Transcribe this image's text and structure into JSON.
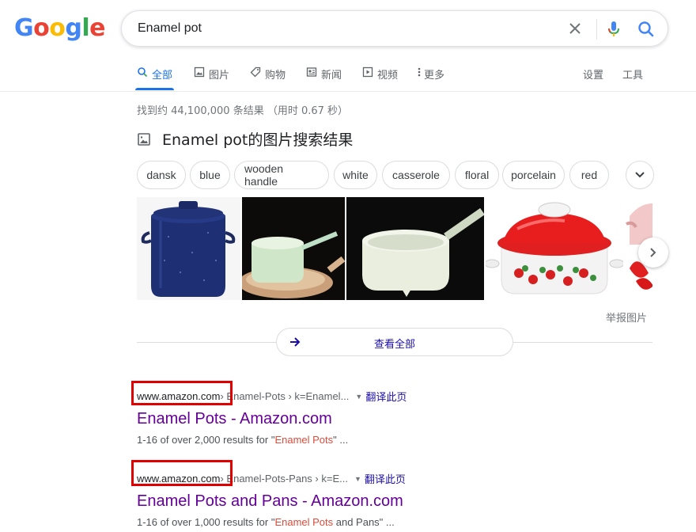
{
  "logo": [
    "G",
    "o",
    "o",
    "g",
    "l",
    "e"
  ],
  "search": {
    "query": "Enamel pot"
  },
  "tabs": [
    {
      "label": "全部",
      "icon": "search-icon",
      "active": true
    },
    {
      "label": "图片",
      "icon": "image-icon"
    },
    {
      "label": "购物",
      "icon": "tag-icon"
    },
    {
      "label": "新闻",
      "icon": "news-icon"
    },
    {
      "label": "视频",
      "icon": "video-icon"
    },
    {
      "label": "更多",
      "icon": "more-vertical-icon"
    }
  ],
  "tools": {
    "settings": "设置",
    "tools": "工具"
  },
  "stats": "找到约 44,100,000 条结果 （用时 0.67 秒）",
  "images_heading": "Enamel pot的图片搜索结果",
  "chips": [
    "dansk",
    "blue",
    "wooden handle",
    "white",
    "casserole",
    "floral",
    "porcelain",
    "red"
  ],
  "report": "举报图片",
  "view_all": "查看全部",
  "results": [
    {
      "domain": "www.amazon.com",
      "path": " › Enamel-Pots › k=Enamel...",
      "translate": "翻译此页",
      "title": "Enamel Pots - Amazon.com",
      "snippet_pre": "1-16 of over 2,000 results for \"",
      "snippet_em": "Enamel Pots",
      "snippet_post": "\" ..."
    },
    {
      "domain": "www.amazon.com",
      "path": " › Enamel-Pots-Pans › k=E...",
      "translate": "翻译此页",
      "title": "Enamel Pots and Pans - Amazon.com",
      "snippet_pre": "1-16 of over 1,000 results for \"",
      "snippet_em": "Enamel Pots",
      "snippet_post": " and Pans\" ..."
    }
  ],
  "colors": {
    "accent": "#1a73e8",
    "visited": "#660099",
    "link": "#1a0dab",
    "highlight": "#e00000"
  }
}
